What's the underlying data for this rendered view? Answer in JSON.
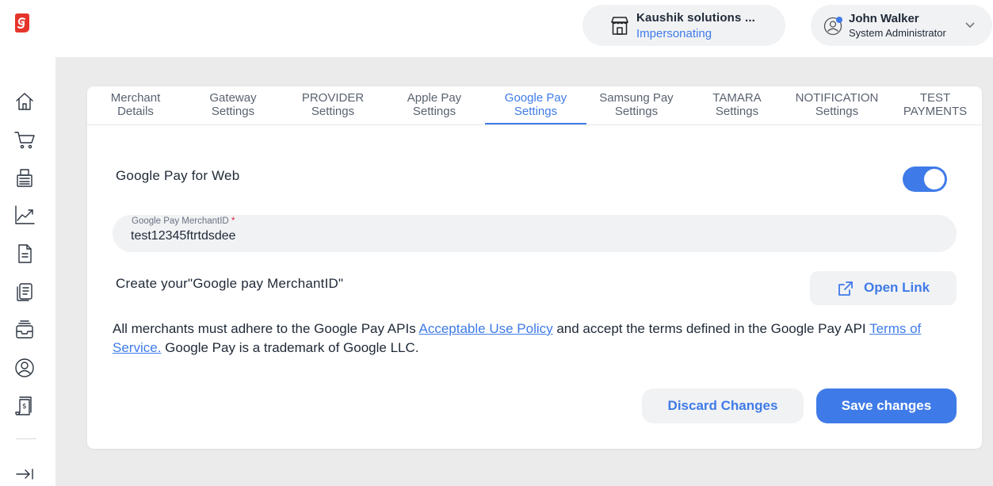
{
  "header": {
    "merchant_name": "Kaushik solutions ...",
    "merchant_status": "Impersonating",
    "user_name": "John Walker",
    "user_role": "System Administrator"
  },
  "tabs": [
    {
      "line1": "Merchant",
      "line2": "Details"
    },
    {
      "line1": "Gateway",
      "line2": "Settings"
    },
    {
      "line1": "PROVIDER",
      "line2": "Settings"
    },
    {
      "line1": "Apple Pay",
      "line2": "Settings"
    },
    {
      "line1": "Google Pay",
      "line2": "Settings"
    },
    {
      "line1": "Samsung Pay",
      "line2": "Settings"
    },
    {
      "line1": "TAMARA",
      "line2": "Settings"
    },
    {
      "line1": "NOTIFICATION",
      "line2": "Settings"
    },
    {
      "line1": "TEST",
      "line2": "PAYMENTS"
    }
  ],
  "active_tab": "Google Pay Settings",
  "google_pay": {
    "web_label": "Google Pay for Web",
    "web_enabled": true,
    "merchant_id_label": "Google Pay MerchantID",
    "merchant_id_required": "*",
    "merchant_id_value": "test12345ftrtdsdee",
    "create_label": "Create your\"Google pay MerchantID\"",
    "open_link_label": "Open Link"
  },
  "policy": {
    "text1": "All merchants must adhere to the Google Pay APIs ",
    "link1": "Acceptable Use Policy",
    "text2": " and accept the terms defined in the Google Pay API ",
    "link2": "Terms of Service.",
    "text3": " Google Pay is a trademark of Google LLC."
  },
  "actions": {
    "discard_label": "Discard Changes",
    "save_label": "Save changes"
  },
  "colors": {
    "accent": "#3f7be8",
    "logo": "#e5352b",
    "background": "#ebebeb",
    "pill": "#f1f2f4"
  }
}
